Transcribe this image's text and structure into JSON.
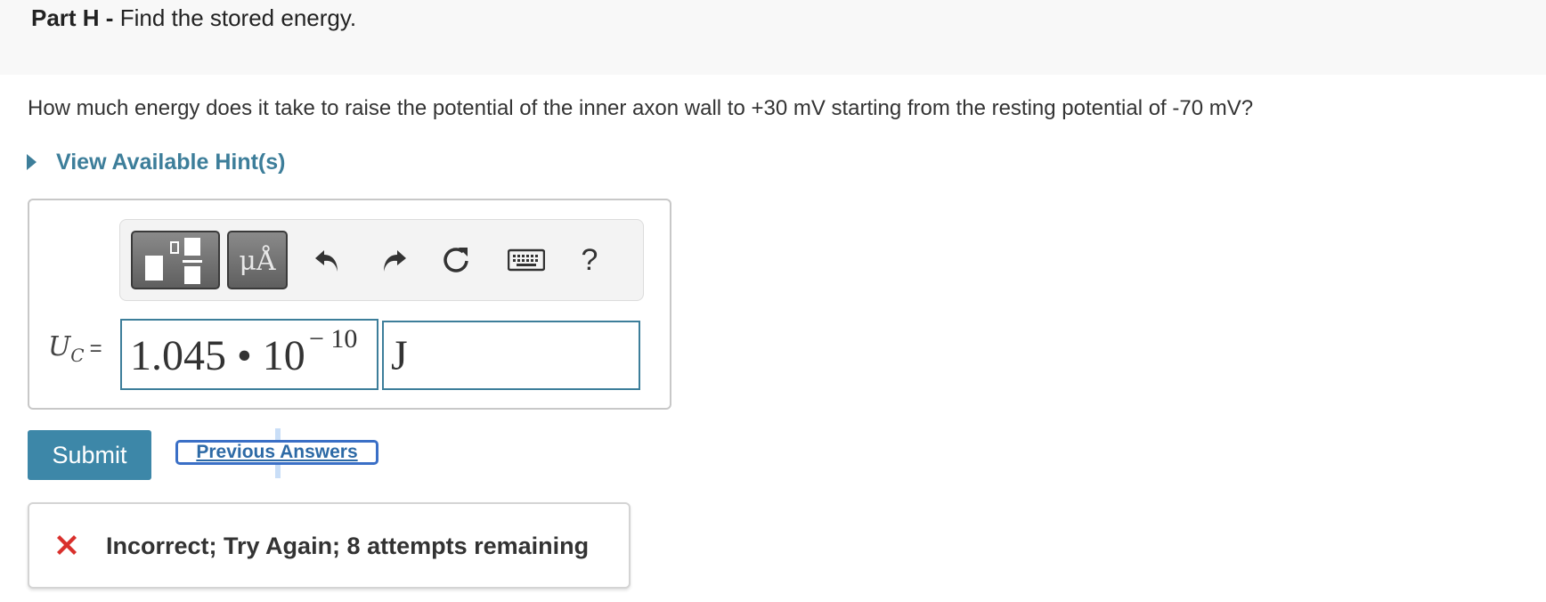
{
  "part": {
    "label": "Part H -",
    "title": "Find the stored energy."
  },
  "question": "How much energy does it take to raise the potential of the inner axon wall to +30 mV starting from the resting potential of -70 mV?",
  "hint": {
    "label": "View Available Hint(s)"
  },
  "toolbar": {
    "units_label": "μÅ",
    "help_label": "?",
    "buttons": [
      "templates-icon",
      "units-icon",
      "undo-icon",
      "redo-icon",
      "reset-icon",
      "keyboard-icon",
      "help-icon"
    ]
  },
  "equation": {
    "variable": "U",
    "subscript": "C",
    "equals": "=",
    "value_mantissa": "1.045 • 10",
    "value_exponent": "− 10",
    "unit": "J"
  },
  "actions": {
    "submit_label": "Submit",
    "previous_answers_label": "Previous Answers"
  },
  "feedback": {
    "message": "Incorrect; Try Again; 8 attempts remaining",
    "status": "incorrect"
  },
  "colors": {
    "accent": "#3d7e9a",
    "submit": "#3d87a8",
    "error": "#d9302c",
    "header_bg": "#f8f8f8"
  }
}
